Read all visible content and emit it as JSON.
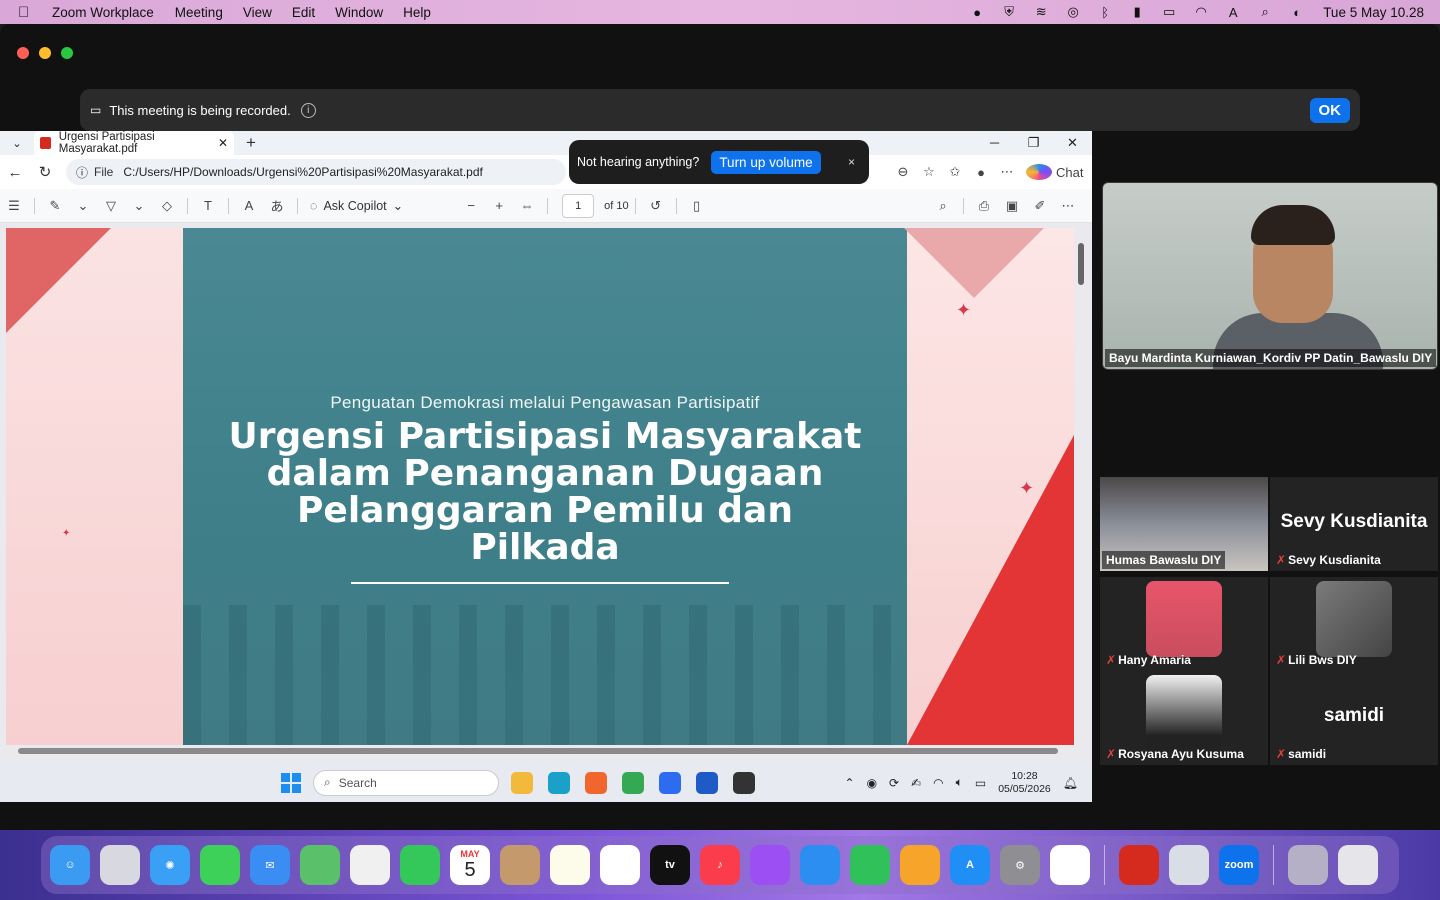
{
  "menubar": {
    "app": "Zoom Workplace",
    "items": [
      "Meeting",
      "View",
      "Edit",
      "Window",
      "Help"
    ],
    "clock": "Tue 5 May  10.28"
  },
  "recording": {
    "text": "This meeting is being recorded.",
    "ok": "OK"
  },
  "toast": {
    "text": "Not hearing anything?",
    "button": "Turn up volume",
    "close": "×"
  },
  "browser": {
    "tab_title": "Urgensi Partisipasi Masyarakat.pdf",
    "file_label": "File",
    "url": "C:/Users/HP/Downloads/Urgensi%20Partisipasi%20Masyarakat.pdf",
    "chat": "Chat"
  },
  "pdf_toolbar": {
    "ask_copilot": "Ask Copilot",
    "page": "1",
    "of": "of 10"
  },
  "slide": {
    "subtitle": "Penguatan Demokrasi melalui Pengawasan Partisipatif",
    "title_lines": [
      "Urgensi Partisipasi Masyarakat",
      "dalam Penanganan Dugaan",
      "Pelanggaran Pemilu dan",
      "Pilkada"
    ]
  },
  "taskbar": {
    "search": "Search",
    "time": "10:28",
    "date": "05/05/2026"
  },
  "participants": {
    "speaker": "Bayu Mardinta Kurniawan_Kordiv PP Datin_Bawaslu DIY",
    "tiles": [
      {
        "label": "Humas Bawaslu DIY"
      },
      {
        "label": "Sevy Kusdianita",
        "big": "Sevy Kusdianita"
      },
      {
        "label": "Hany Amaria"
      },
      {
        "label": "Lili Bws DIY"
      },
      {
        "label": "Rosyana Ayu Kusuma"
      },
      {
        "label": "samidi",
        "big": "samidi"
      }
    ]
  },
  "dock": {
    "calendar_month": "MAY",
    "calendar_day": "5",
    "zoom": "zoom"
  },
  "colors": {
    "zoom_blue": "#0e72ed",
    "slide_teal": "#4a8993",
    "slide_red": "#e33535"
  }
}
